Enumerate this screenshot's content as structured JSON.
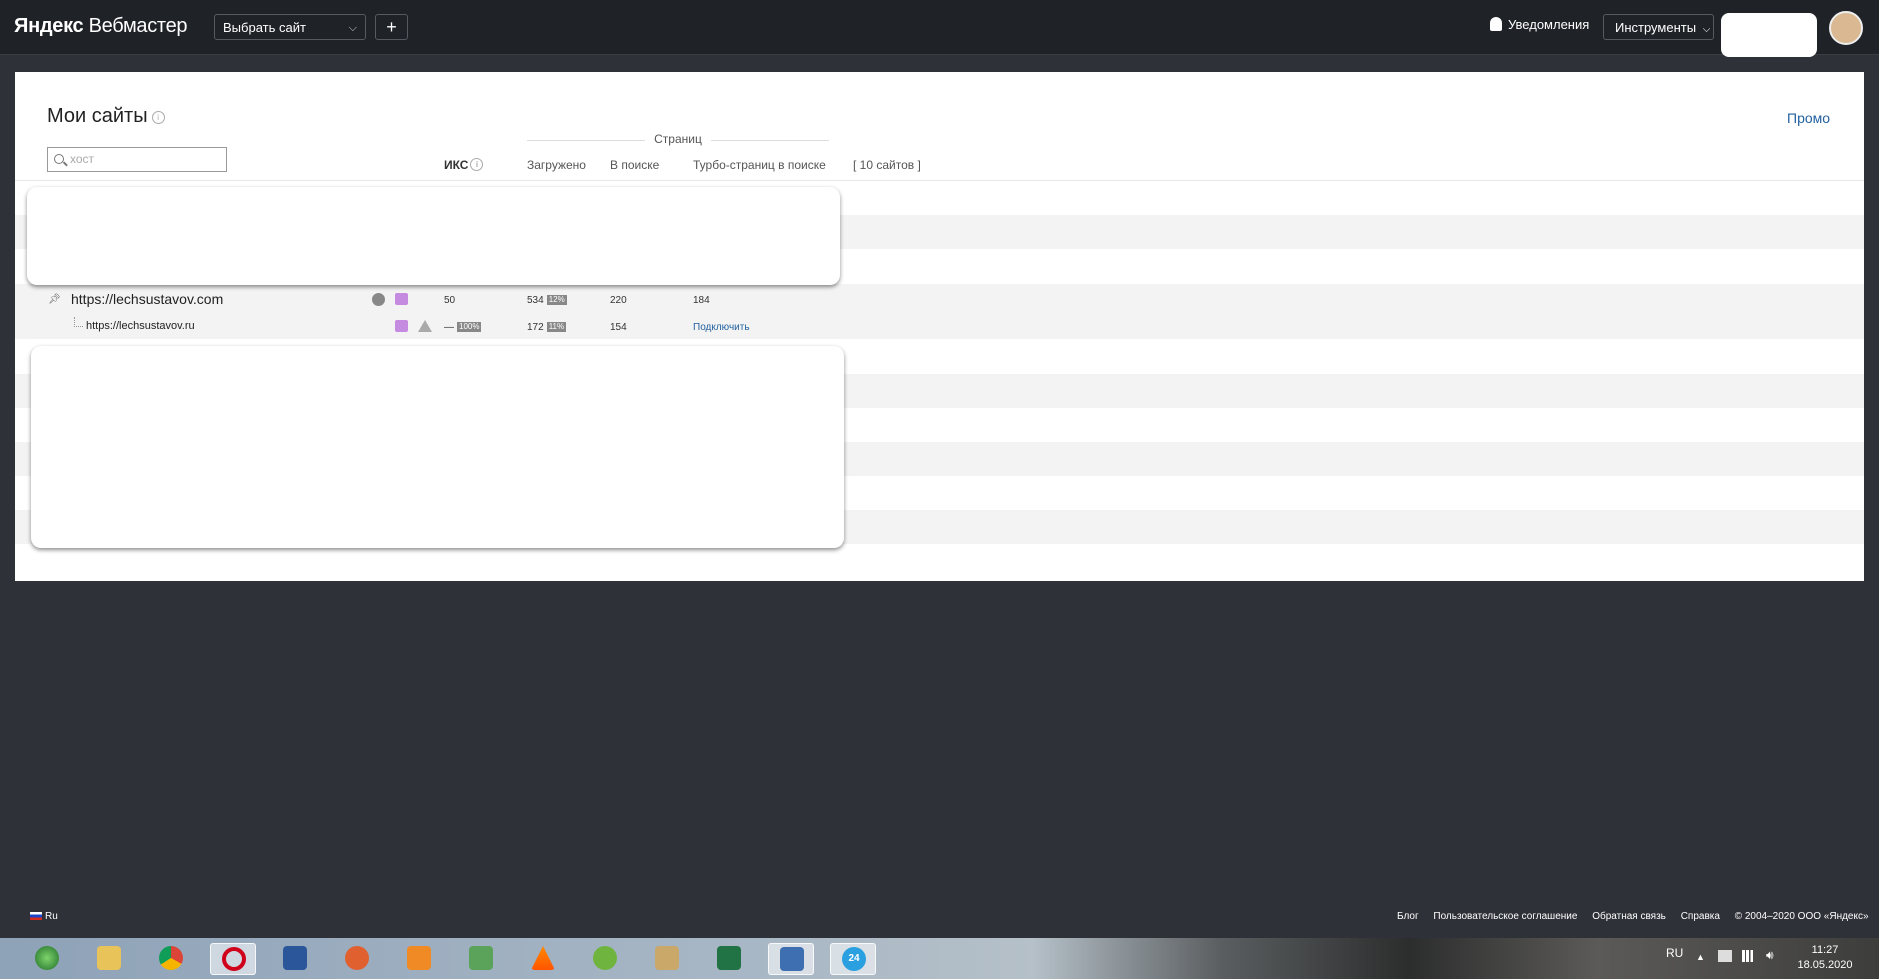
{
  "header": {
    "logo_brand": "Яндекс",
    "logo_product": "Вебмастер",
    "site_select": "Выбрать сайт",
    "add_button": "+",
    "notifications": "Уведомления",
    "tools": "Инструменты"
  },
  "main": {
    "title": "Мои сайты",
    "promo": "Промо",
    "search_placeholder": "хост",
    "pages_group": "Страниц",
    "columns": {
      "iks": "ИКС",
      "loaded": "Загружено",
      "in_search": "В поиске",
      "turbo": "Турбо-страниц в поиске",
      "count": "[ 10 сайтов ]"
    },
    "rows": [
      {
        "url": "https://lechsustavov.com",
        "iks": "50",
        "loaded": "534",
        "loaded_pct": "12%",
        "in_search": "220",
        "turbo": "184"
      },
      {
        "url": "https://lechsustavov.ru",
        "iks": "—",
        "iks_pct": "100%",
        "loaded": "172",
        "loaded_pct": "11%",
        "in_search": "154",
        "turbo": "Подключить"
      }
    ]
  },
  "footer": {
    "lang": "Ru",
    "links": [
      "Блог",
      "Пользовательское соглашение",
      "Обратная связь",
      "Справка",
      "© 2004–2020  ООО «Яндекс»"
    ]
  },
  "taskbar": {
    "lang": "RU",
    "time": "11:27",
    "date": "18.05.2020",
    "apps": [
      "start-orb-icon",
      "explorer-icon",
      "chrome-icon",
      "opera-icon",
      "word-icon",
      "eye-app-icon",
      "media-player-icon",
      "app-2-icon",
      "vlc-icon",
      "utorrent-icon",
      "folder-app-icon",
      "excel-icon",
      "network-app-icon",
      "app-24-icon"
    ],
    "app24_label": "24"
  }
}
